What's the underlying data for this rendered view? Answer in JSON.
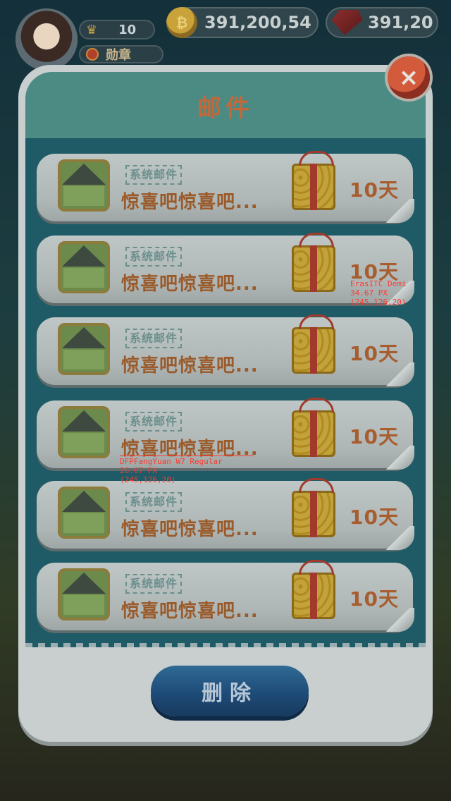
{
  "hud": {
    "level": "10",
    "medal_label": "勋章",
    "coins": "391,200,54",
    "gems": "391,20"
  },
  "modal": {
    "title": "邮件",
    "close_label": "×",
    "delete_label": "删除"
  },
  "mails": [
    {
      "tag": "系统邮件",
      "subject": "惊喜吧惊喜吧...",
      "days": "10天"
    },
    {
      "tag": "系统邮件",
      "subject": "惊喜吧惊喜吧...",
      "days": "10天"
    },
    {
      "tag": "系统邮件",
      "subject": "惊喜吧惊喜吧...",
      "days": "10天"
    },
    {
      "tag": "系统邮件",
      "subject": "惊喜吧惊喜吧...",
      "days": "10天"
    },
    {
      "tag": "系统邮件",
      "subject": "惊喜吧惊喜吧...",
      "days": "10天"
    },
    {
      "tag": "系统邮件",
      "subject": "惊喜吧惊喜吧...",
      "days": "10天"
    }
  ],
  "annotations": {
    "days_font": "ErasITC Demi\n34.67 PX\n(245,126,20)",
    "subject_font": "DFPFangYuan W7 Regular\n26.67 PX\n(245,126,20)"
  },
  "colors": {
    "header": "#4c8b83",
    "list_bg": "#1f5b66",
    "text_orange": "#c1693a",
    "delete_blue": "#1e4b77"
  }
}
